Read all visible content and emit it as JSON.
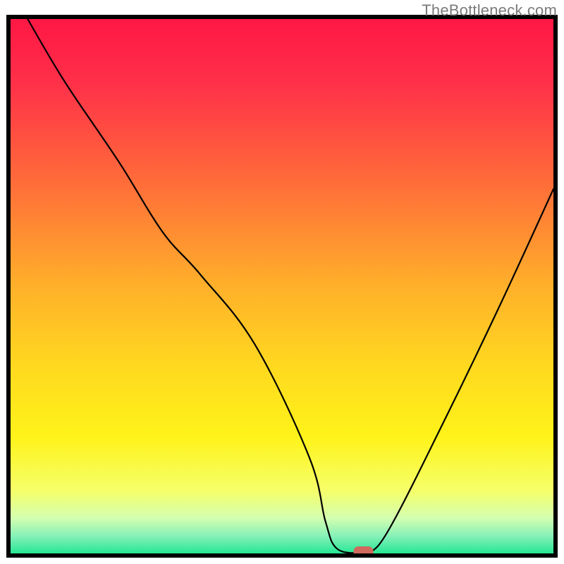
{
  "watermark": "TheBottleneck.com",
  "chart_data": {
    "type": "line",
    "title": "",
    "xlabel": "",
    "ylabel": "",
    "xlim": [
      0,
      100
    ],
    "ylim": [
      0,
      100
    ],
    "series": [
      {
        "name": "bottleneck-curve",
        "x": [
          3,
          10,
          20,
          28,
          35,
          45,
          55,
          58,
          60,
          64,
          66,
          70,
          80,
          90,
          100
        ],
        "y": [
          100,
          88,
          73,
          60,
          52,
          39,
          18,
          6,
          1,
          0,
          0,
          5,
          25,
          46,
          68
        ]
      }
    ],
    "marker": {
      "x": 65,
      "y": 0,
      "color": "#cf6a5d"
    },
    "gradient_stops": [
      {
        "offset": 0.0,
        "color": "#ff1744"
      },
      {
        "offset": 0.12,
        "color": "#ff2f49"
      },
      {
        "offset": 0.3,
        "color": "#ff6a3a"
      },
      {
        "offset": 0.5,
        "color": "#ffb02a"
      },
      {
        "offset": 0.65,
        "color": "#ffd91f"
      },
      {
        "offset": 0.78,
        "color": "#fff31a"
      },
      {
        "offset": 0.88,
        "color": "#f5ff6a"
      },
      {
        "offset": 0.93,
        "color": "#d4ffb0"
      },
      {
        "offset": 0.965,
        "color": "#83f0b8"
      },
      {
        "offset": 1.0,
        "color": "#19e68f"
      }
    ],
    "frame": {
      "color": "#000000",
      "width": 6
    }
  }
}
